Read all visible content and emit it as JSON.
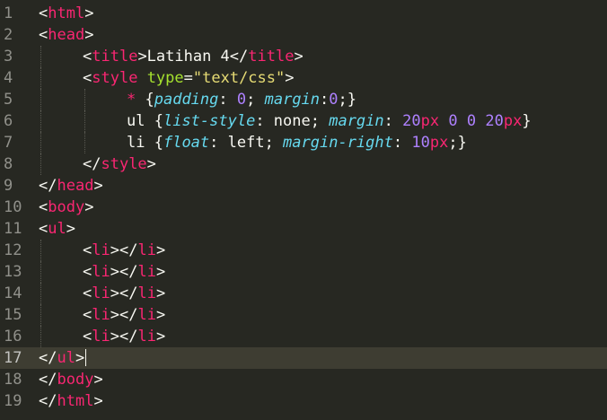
{
  "theme": {
    "background": "#272822",
    "current_line": "#3e3d32",
    "gutter_text": "#90908a",
    "plain": "#f8f8f2",
    "tag": "#f92672",
    "attribute": "#a6e22e",
    "string": "#e6db74",
    "property": "#66d9ef",
    "number": "#ae81ff"
  },
  "editor": {
    "current_line": 17,
    "lines": [
      {
        "num": "1",
        "indent": 0,
        "tokens": [
          {
            "t": "<",
            "c": "plain"
          },
          {
            "t": "html",
            "c": "tag"
          },
          {
            "t": ">",
            "c": "plain"
          }
        ]
      },
      {
        "num": "2",
        "indent": 0,
        "tokens": [
          {
            "t": "<",
            "c": "plain"
          },
          {
            "t": "head",
            "c": "tag"
          },
          {
            "t": ">",
            "c": "plain"
          }
        ]
      },
      {
        "num": "3",
        "indent": 1,
        "tokens": [
          {
            "t": "<",
            "c": "plain"
          },
          {
            "t": "title",
            "c": "tag"
          },
          {
            "t": ">Latihan 4</",
            "c": "plain"
          },
          {
            "t": "title",
            "c": "tag"
          },
          {
            "t": ">",
            "c": "plain"
          }
        ]
      },
      {
        "num": "4",
        "indent": 1,
        "tokens": [
          {
            "t": "<",
            "c": "plain"
          },
          {
            "t": "style",
            "c": "tag"
          },
          {
            "t": " ",
            "c": "plain"
          },
          {
            "t": "type",
            "c": "attribute"
          },
          {
            "t": "=",
            "c": "plain"
          },
          {
            "t": "\"text/css\"",
            "c": "string"
          },
          {
            "t": ">",
            "c": "plain"
          }
        ]
      },
      {
        "num": "5",
        "indent": 2,
        "tokens": [
          {
            "t": "* ",
            "c": "tag"
          },
          {
            "t": "{",
            "c": "plain"
          },
          {
            "t": "padding",
            "c": "property",
            "i": true
          },
          {
            "t": ": ",
            "c": "plain"
          },
          {
            "t": "0",
            "c": "number"
          },
          {
            "t": "; ",
            "c": "plain"
          },
          {
            "t": "margin",
            "c": "property",
            "i": true
          },
          {
            "t": ":",
            "c": "plain"
          },
          {
            "t": "0",
            "c": "number"
          },
          {
            "t": ";}",
            "c": "plain"
          }
        ]
      },
      {
        "num": "6",
        "indent": 2,
        "tokens": [
          {
            "t": "ul ",
            "c": "plain"
          },
          {
            "t": "{",
            "c": "plain"
          },
          {
            "t": "list-style",
            "c": "property",
            "i": true
          },
          {
            "t": ": none; ",
            "c": "plain"
          },
          {
            "t": "margin",
            "c": "property",
            "i": true
          },
          {
            "t": ": ",
            "c": "plain"
          },
          {
            "t": "20",
            "c": "number"
          },
          {
            "t": "px",
            "c": "tag"
          },
          {
            "t": " ",
            "c": "plain"
          },
          {
            "t": "0",
            "c": "number"
          },
          {
            "t": " ",
            "c": "plain"
          },
          {
            "t": "0",
            "c": "number"
          },
          {
            "t": " ",
            "c": "plain"
          },
          {
            "t": "20",
            "c": "number"
          },
          {
            "t": "px",
            "c": "tag"
          },
          {
            "t": "}",
            "c": "plain"
          }
        ]
      },
      {
        "num": "7",
        "indent": 2,
        "tokens": [
          {
            "t": "li ",
            "c": "plain"
          },
          {
            "t": "{",
            "c": "plain"
          },
          {
            "t": "float",
            "c": "property",
            "i": true
          },
          {
            "t": ": left; ",
            "c": "plain"
          },
          {
            "t": "margin-right",
            "c": "property",
            "i": true
          },
          {
            "t": ": ",
            "c": "plain"
          },
          {
            "t": "10",
            "c": "number"
          },
          {
            "t": "px",
            "c": "tag"
          },
          {
            "t": ";}",
            "c": "plain"
          }
        ]
      },
      {
        "num": "8",
        "indent": 1,
        "tokens": [
          {
            "t": "</",
            "c": "plain"
          },
          {
            "t": "style",
            "c": "tag"
          },
          {
            "t": ">",
            "c": "plain"
          }
        ]
      },
      {
        "num": "9",
        "indent": 0,
        "tokens": [
          {
            "t": "</",
            "c": "plain"
          },
          {
            "t": "head",
            "c": "tag"
          },
          {
            "t": ">",
            "c": "plain"
          }
        ]
      },
      {
        "num": "10",
        "indent": 0,
        "tokens": [
          {
            "t": "<",
            "c": "plain"
          },
          {
            "t": "body",
            "c": "tag"
          },
          {
            "t": ">",
            "c": "plain"
          }
        ]
      },
      {
        "num": "11",
        "indent": 0,
        "tokens": [
          {
            "t": "<",
            "c": "plain"
          },
          {
            "t": "ul",
            "c": "tag"
          },
          {
            "t": ">",
            "c": "plain"
          }
        ]
      },
      {
        "num": "12",
        "indent": 1,
        "tokens": [
          {
            "t": "<",
            "c": "plain"
          },
          {
            "t": "li",
            "c": "tag"
          },
          {
            "t": "></",
            "c": "plain"
          },
          {
            "t": "li",
            "c": "tag"
          },
          {
            "t": ">",
            "c": "plain"
          }
        ]
      },
      {
        "num": "13",
        "indent": 1,
        "tokens": [
          {
            "t": "<",
            "c": "plain"
          },
          {
            "t": "li",
            "c": "tag"
          },
          {
            "t": "></",
            "c": "plain"
          },
          {
            "t": "li",
            "c": "tag"
          },
          {
            "t": ">",
            "c": "plain"
          }
        ]
      },
      {
        "num": "14",
        "indent": 1,
        "tokens": [
          {
            "t": "<",
            "c": "plain"
          },
          {
            "t": "li",
            "c": "tag"
          },
          {
            "t": "></",
            "c": "plain"
          },
          {
            "t": "li",
            "c": "tag"
          },
          {
            "t": ">",
            "c": "plain"
          }
        ]
      },
      {
        "num": "15",
        "indent": 1,
        "tokens": [
          {
            "t": "<",
            "c": "plain"
          },
          {
            "t": "li",
            "c": "tag"
          },
          {
            "t": "></",
            "c": "plain"
          },
          {
            "t": "li",
            "c": "tag"
          },
          {
            "t": ">",
            "c": "plain"
          }
        ]
      },
      {
        "num": "16",
        "indent": 1,
        "tokens": [
          {
            "t": "<",
            "c": "plain"
          },
          {
            "t": "li",
            "c": "tag"
          },
          {
            "t": "></",
            "c": "plain"
          },
          {
            "t": "li",
            "c": "tag"
          },
          {
            "t": ">",
            "c": "plain"
          }
        ]
      },
      {
        "num": "17",
        "indent": 0,
        "tokens": [
          {
            "t": "</",
            "c": "plain"
          },
          {
            "t": "ul",
            "c": "tag"
          },
          {
            "t": ">",
            "c": "plain"
          }
        ]
      },
      {
        "num": "18",
        "indent": 0,
        "tokens": [
          {
            "t": "</",
            "c": "plain"
          },
          {
            "t": "body",
            "c": "tag"
          },
          {
            "t": ">",
            "c": "plain"
          }
        ]
      },
      {
        "num": "19",
        "indent": 0,
        "tokens": [
          {
            "t": "</",
            "c": "plain"
          },
          {
            "t": "html",
            "c": "tag"
          },
          {
            "t": ">",
            "c": "plain"
          }
        ]
      }
    ]
  }
}
